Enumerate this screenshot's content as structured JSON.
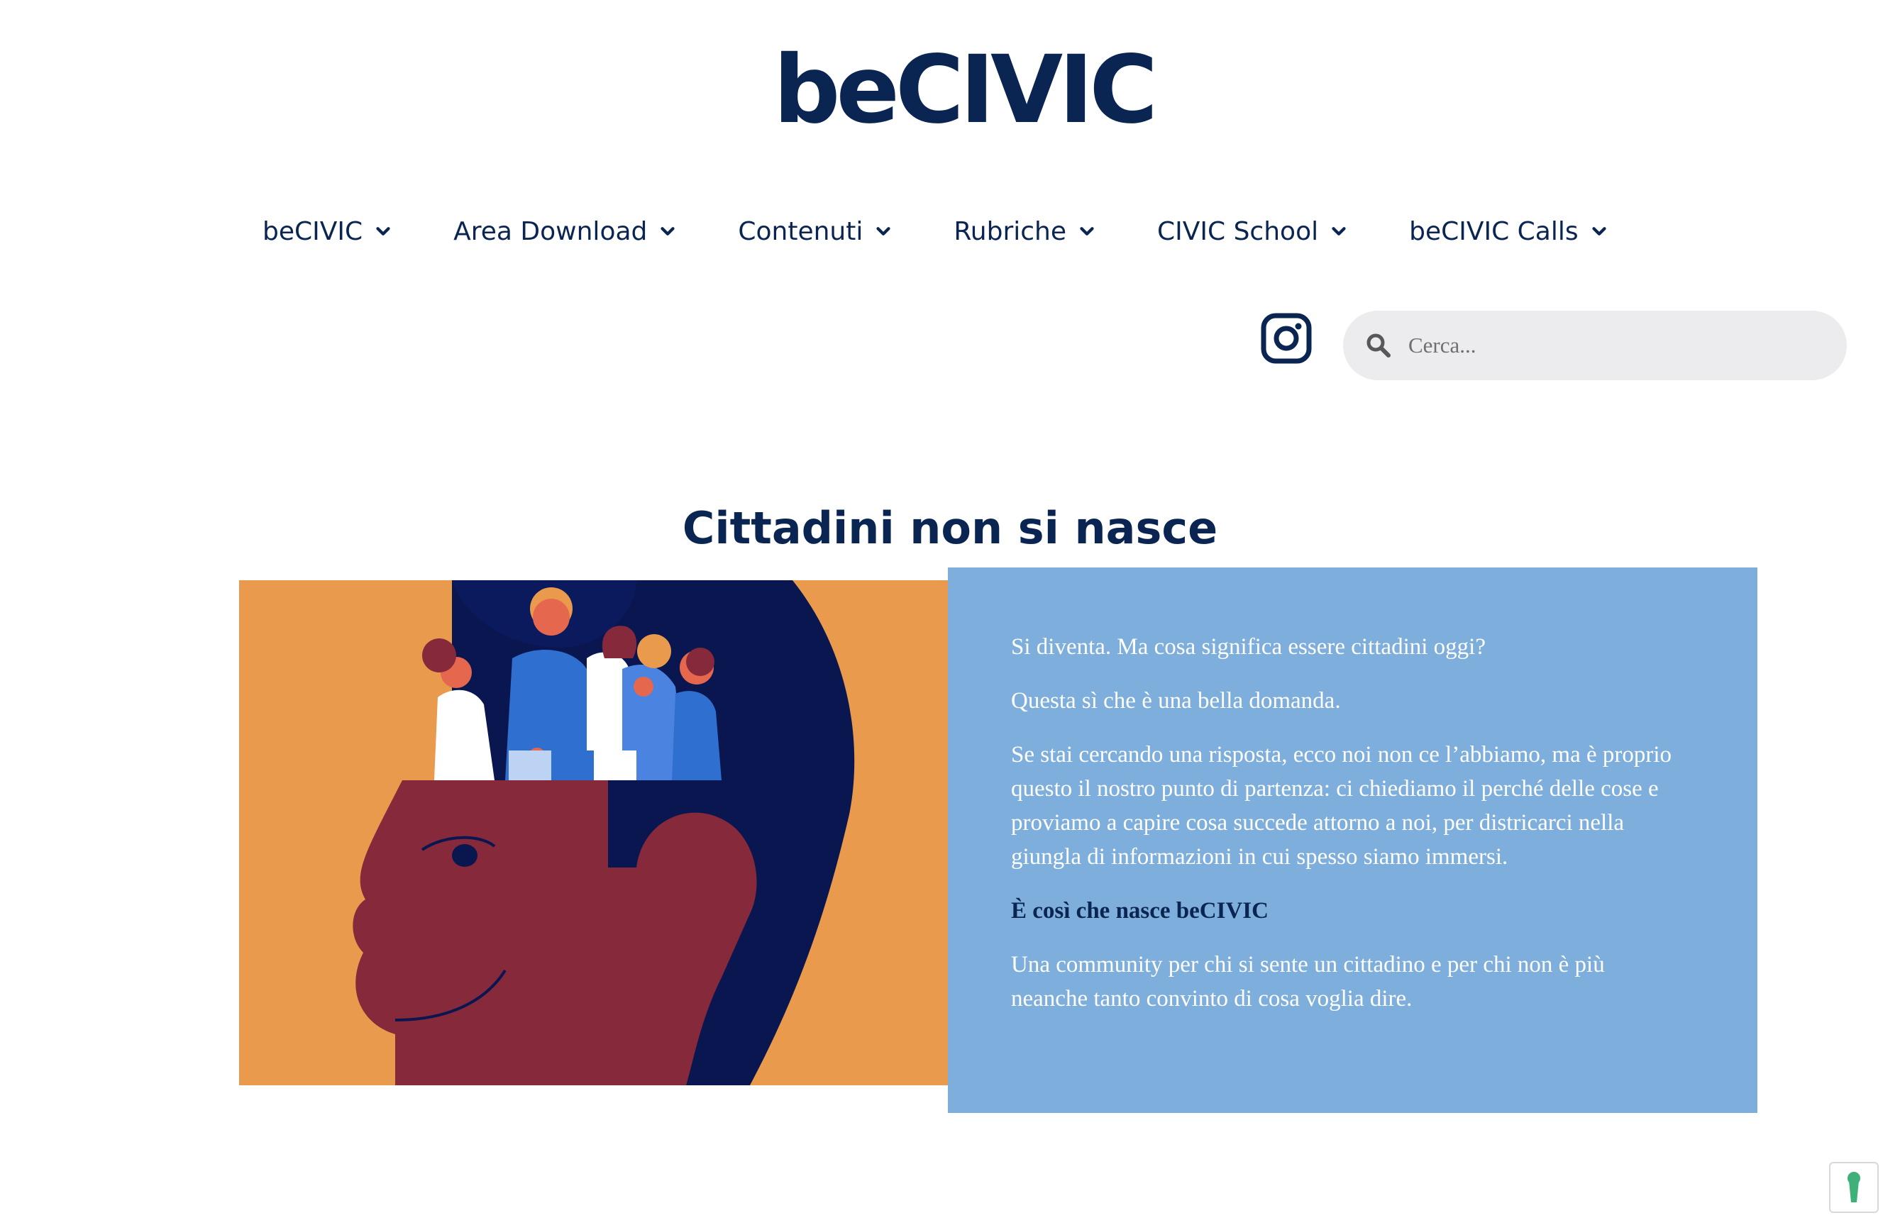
{
  "header": {
    "logo_text": "beCIVIC"
  },
  "nav": {
    "items": [
      {
        "label": "beCIVIC",
        "icon": "chevron-down-icon"
      },
      {
        "label": "Area Download",
        "icon": "chevron-down-icon"
      },
      {
        "label": "Contenuti",
        "icon": "chevron-down-icon"
      },
      {
        "label": "Rubriche",
        "icon": "chevron-down-icon"
      },
      {
        "label": "CIVIC School",
        "icon": "chevron-down-icon"
      },
      {
        "label": "beCIVIC Calls",
        "icon": "chevron-down-icon"
      }
    ]
  },
  "social": {
    "icon": "instagram-icon"
  },
  "search": {
    "placeholder": "Cerca...",
    "value": "",
    "icon": "search-icon"
  },
  "hero": {
    "title": "Cittadini non si nasce",
    "paragraphs": [
      "Si diventa. Ma cosa significa essere cittadini oggi?",
      "Questa sì che è una bella domanda.",
      "Se stai cercando una risposta, ecco noi non ce l’abbiamo, ma è proprio questo il nostro punto di partenza: ci chiediamo il perché delle cose e proviamo a capire cosa succede attorno a noi, per districarci nella giungla di informazioni in cui spesso siamo immersi.",
      "È così che nasce beCIVIC",
      "Una community per chi si sente un cittadino e per chi non è più neanche tanto convinto di cosa voglia dire."
    ]
  },
  "accessibility": {
    "icon": "accessibility-icon"
  },
  "colors": {
    "brand_navy": "#0a2552",
    "text_box_blue": "#7eaedc",
    "illustration_orange": "#ea9a4c",
    "illustration_maroon": "#85293b",
    "search_bg": "#ececee"
  }
}
